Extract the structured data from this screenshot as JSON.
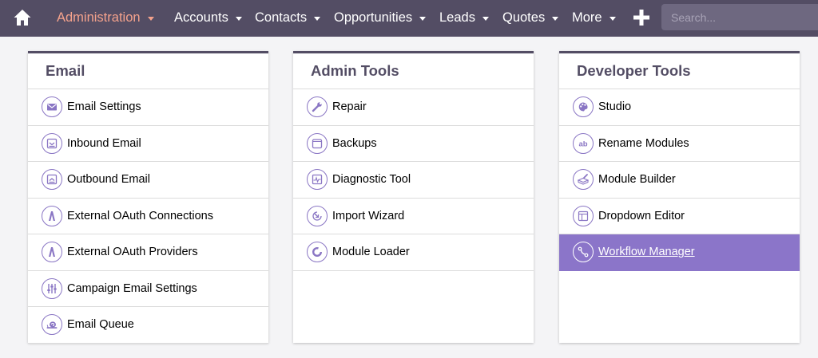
{
  "nav": {
    "items": [
      {
        "label": "Administration",
        "active": true
      },
      {
        "label": "Accounts"
      },
      {
        "label": "Contacts"
      },
      {
        "label": "Opportunities"
      },
      {
        "label": "Leads"
      },
      {
        "label": "Quotes"
      },
      {
        "label": "More"
      }
    ],
    "home_icon": "home-icon",
    "create_icon": "plus-icon",
    "search_placeholder": "Search..."
  },
  "colors": {
    "navbar": "#534d64",
    "active_nav": "#f4a28c",
    "accent": "#8b75c9",
    "panel_title": "#534d64"
  },
  "panels": [
    {
      "title": "Email",
      "items": [
        {
          "label": "Email Settings",
          "icon": "envelope-icon"
        },
        {
          "label": "Inbound Email",
          "icon": "inbox-icon"
        },
        {
          "label": "Outbound Email",
          "icon": "outbox-icon"
        },
        {
          "label": "External OAuth Connections",
          "icon": "oauth-icon"
        },
        {
          "label": "External OAuth Providers",
          "icon": "oauth-icon"
        },
        {
          "label": "Campaign Email Settings",
          "icon": "sliders-icon"
        },
        {
          "label": "Email Queue",
          "icon": "snail-icon"
        }
      ]
    },
    {
      "title": "Admin Tools",
      "items": [
        {
          "label": "Repair",
          "icon": "wrench-icon"
        },
        {
          "label": "Backups",
          "icon": "backup-icon"
        },
        {
          "label": "Diagnostic Tool",
          "icon": "diagnostic-icon"
        },
        {
          "label": "Import Wizard",
          "icon": "import-icon"
        },
        {
          "label": "Module Loader",
          "icon": "loader-icon"
        }
      ]
    },
    {
      "title": "Developer Tools",
      "items": [
        {
          "label": "Studio",
          "icon": "palette-icon"
        },
        {
          "label": "Rename Modules",
          "icon": "rename-ab-icon"
        },
        {
          "label": "Module Builder",
          "icon": "builder-icon"
        },
        {
          "label": "Dropdown Editor",
          "icon": "dropdown-editor-icon"
        },
        {
          "label": "Workflow Manager",
          "icon": "workflow-icon",
          "highlighted": true
        }
      ]
    }
  ]
}
